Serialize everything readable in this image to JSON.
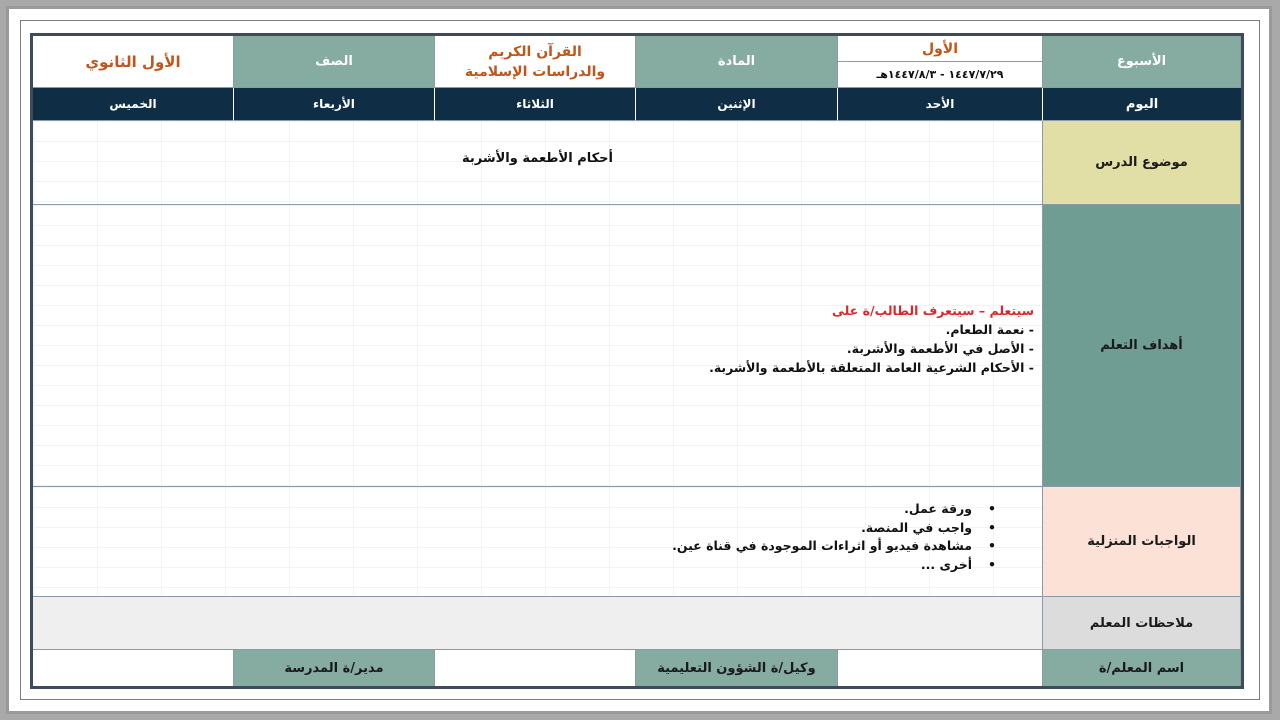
{
  "header": {
    "week_label": "الأسبوع",
    "week_value": "الأول",
    "week_dates": "١٤٤٧/٧/٢٩ - ١٤٤٧/٨/٣هـ",
    "subject_label": "المادة",
    "subject_value": "القرآن الكريم والدراسات الإسلامية",
    "grade_label": "الصف",
    "grade_value": "الأول الثانوي"
  },
  "days": {
    "label": "اليوم",
    "items": [
      "الأحد",
      "الإثنين",
      "الثلاثاء",
      "الأربعاء",
      "الخميس"
    ]
  },
  "lesson": {
    "label": "موضوع الدرس",
    "value": "أحكام الأطعمة والأشربة"
  },
  "objectives": {
    "label": "أهداف التعلم",
    "intro": "سيتعلم – سيتعرف الطالب/ة على",
    "items": [
      "- نعمة الطعام.",
      "- الأصل في الأطعمة والأشربة.",
      "- الأحكام الشرعية العامة المتعلقة بالأطعمة والأشربة."
    ]
  },
  "homework": {
    "label": "الواجبات المنزلية",
    "items": [
      "ورقة عمل.",
      "واجب في المنصة.",
      "مشاهدة فيديو أو اثراءات الموجودة في قناة عين.",
      "أخرى ..."
    ]
  },
  "notes": {
    "label": "ملاحظات المعلم"
  },
  "footer": {
    "teacher_label": "اسم المعلم/ة",
    "deputy_label": "وكيل/ة الشؤون التعليمية",
    "principal_label": "مدير/ة المدرسة"
  },
  "colors": {
    "teal": "#86aba1",
    "navy": "#0f2e45",
    "khaki": "#e2dfa6",
    "peach": "#fbe1d6",
    "orange_text": "#c0561a",
    "red_text": "#e0262b"
  }
}
